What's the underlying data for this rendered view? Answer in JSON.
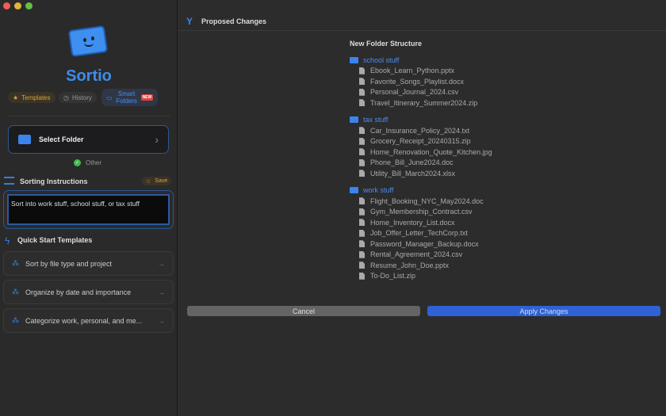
{
  "app": {
    "title": "Sortio"
  },
  "tabs": [
    {
      "label": "Templates",
      "icon": "star-icon"
    },
    {
      "label": "History",
      "icon": "clock-icon"
    },
    {
      "label": "Smart Folders",
      "badge": "NEW",
      "icon": "folder-icon"
    }
  ],
  "select_folder": {
    "label": "Select Folder"
  },
  "status": {
    "label": "Other"
  },
  "instructions": {
    "title": "Sorting Instructions",
    "save_label": "Save",
    "value": "Sort into work stuff, school stuff, or tax stuff"
  },
  "quick_start": {
    "title": "Quick Start Templates",
    "items": [
      "Sort by file type and project",
      "Organize by date and importance",
      "Categorize work, personal, and me..."
    ]
  },
  "main": {
    "header": "Proposed Changes",
    "structure_title": "New Folder Structure",
    "folders": [
      {
        "name": "school stuff",
        "files": [
          "Ebook_Learn_Python.pptx",
          "Favorite_Songs_Playlist.docx",
          "Personal_Journal_2024.csv",
          "Travel_Itinerary_Summer2024.zip"
        ]
      },
      {
        "name": "tax stuff",
        "files": [
          "Car_Insurance_Policy_2024.txt",
          "Grocery_Receipt_20240315.zip",
          "Home_Renovation_Quote_Kitchen.jpg",
          "Phone_Bill_June2024.doc",
          "Utility_Bill_March2024.xlsx"
        ]
      },
      {
        "name": "work stuff",
        "files": [
          "Flight_Booking_NYC_May2024.doc",
          "Gym_Membership_Contract.csv",
          "Home_Inventory_List.docx",
          "Job_Offer_Letter_TechCorp.txt",
          "Password_Manager_Backup.docx",
          "Rental_Agreement_2024.csv",
          "Resume_John_Doe.pptx",
          "To-Do_List.zip"
        ]
      }
    ],
    "cancel_label": "Cancel",
    "apply_label": "Apply Changes"
  },
  "colors": {
    "accent": "#3a84ee",
    "apply": "#2f62d6",
    "badge": "#e0443e"
  }
}
